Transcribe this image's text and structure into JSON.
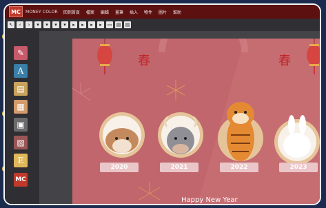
{
  "app": {
    "logo": "MC",
    "name": "MONEY COLOR",
    "menu": [
      "回到首頁",
      "檔案",
      "編輯",
      "畫筆",
      "插入",
      "物件",
      "圖片",
      "幫助"
    ]
  },
  "toolbar": {
    "buttons": [
      "arrow",
      "back",
      "forward",
      "b1",
      "b2",
      "b3",
      "b4",
      "b5",
      "b6",
      "b7",
      "b8",
      "b9",
      "b10",
      "b11"
    ]
  },
  "palette": {
    "items": [
      {
        "name": "brush-tool-icon",
        "glyph": "✎",
        "color": "#c85a6a"
      },
      {
        "name": "text-tool-icon",
        "glyph": "A",
        "color": "#3a7fa8"
      },
      {
        "name": "paper-tool-icon",
        "glyph": "▤",
        "color": "#c9a35c"
      },
      {
        "name": "grid-tool-icon",
        "glyph": "▦",
        "color": "#d49b6c"
      },
      {
        "name": "image-tool-icon",
        "glyph": "▣",
        "color": "#6b6b6b"
      },
      {
        "name": "photo-tool-icon",
        "glyph": "▧",
        "color": "#9a5555"
      },
      {
        "name": "note-tool-icon",
        "glyph": "E",
        "color": "#e0b85a"
      },
      {
        "name": "mc-logo-icon",
        "glyph": "MC",
        "color": "#c0392b"
      }
    ]
  },
  "canvas": {
    "spring_char": "春",
    "greeting": "Happy New Year",
    "animals": [
      {
        "year": "2020",
        "animal": "rat"
      },
      {
        "year": "2021",
        "animal": "ox"
      },
      {
        "year": "2022",
        "animal": "tiger"
      },
      {
        "year": "2023",
        "animal": "rabbit"
      }
    ]
  }
}
